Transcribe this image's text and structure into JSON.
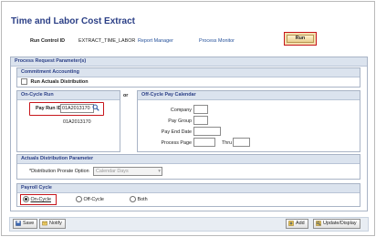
{
  "page": {
    "title": "Time and Labor Cost Extract"
  },
  "header": {
    "run_control_label": "Run Control ID",
    "run_control_value": "EXTRACT_TIME_LABOR",
    "report_manager": "Report Manager",
    "process_monitor": "Process Monitor",
    "run_button": "Run"
  },
  "process_request": {
    "title": "Process Request Parameter(s)",
    "commitment": {
      "title": "Commitment Accounting",
      "run_actuals_label": "Run Actuals Distribution",
      "run_actuals_checked": false
    },
    "on_cycle": {
      "title": "On-Cycle Run",
      "pay_run_label": "Pay Run ID",
      "pay_run_value": "01A2013170",
      "pay_run_description": "01A2013170"
    },
    "or_label": "or",
    "off_cycle": {
      "title": "Off-Cycle Pay Calendar",
      "company_label": "Company",
      "pay_group_label": "Pay Group",
      "pay_end_date_label": "Pay End Date",
      "process_page_label": "Process Page",
      "thru_label": "Thru"
    },
    "actuals_distribution": {
      "title": "Actuals Distribution Parameter",
      "prorate_label": "*Distribution Prorate Option",
      "prorate_value": "Calendar Days"
    },
    "payroll_cycle": {
      "title": "Payroll Cycle",
      "options": [
        "On-Cycle",
        "Off-Cycle",
        "Both"
      ],
      "selected": "On-Cycle"
    }
  },
  "footer": {
    "save": "Save",
    "notify": "Notify",
    "add": "Add",
    "update_display": "Update/Display"
  },
  "colors": {
    "title": "#2b3f86",
    "link": "#24509a",
    "highlight": "#c7161c",
    "panel_header": "#dbe3ee"
  }
}
